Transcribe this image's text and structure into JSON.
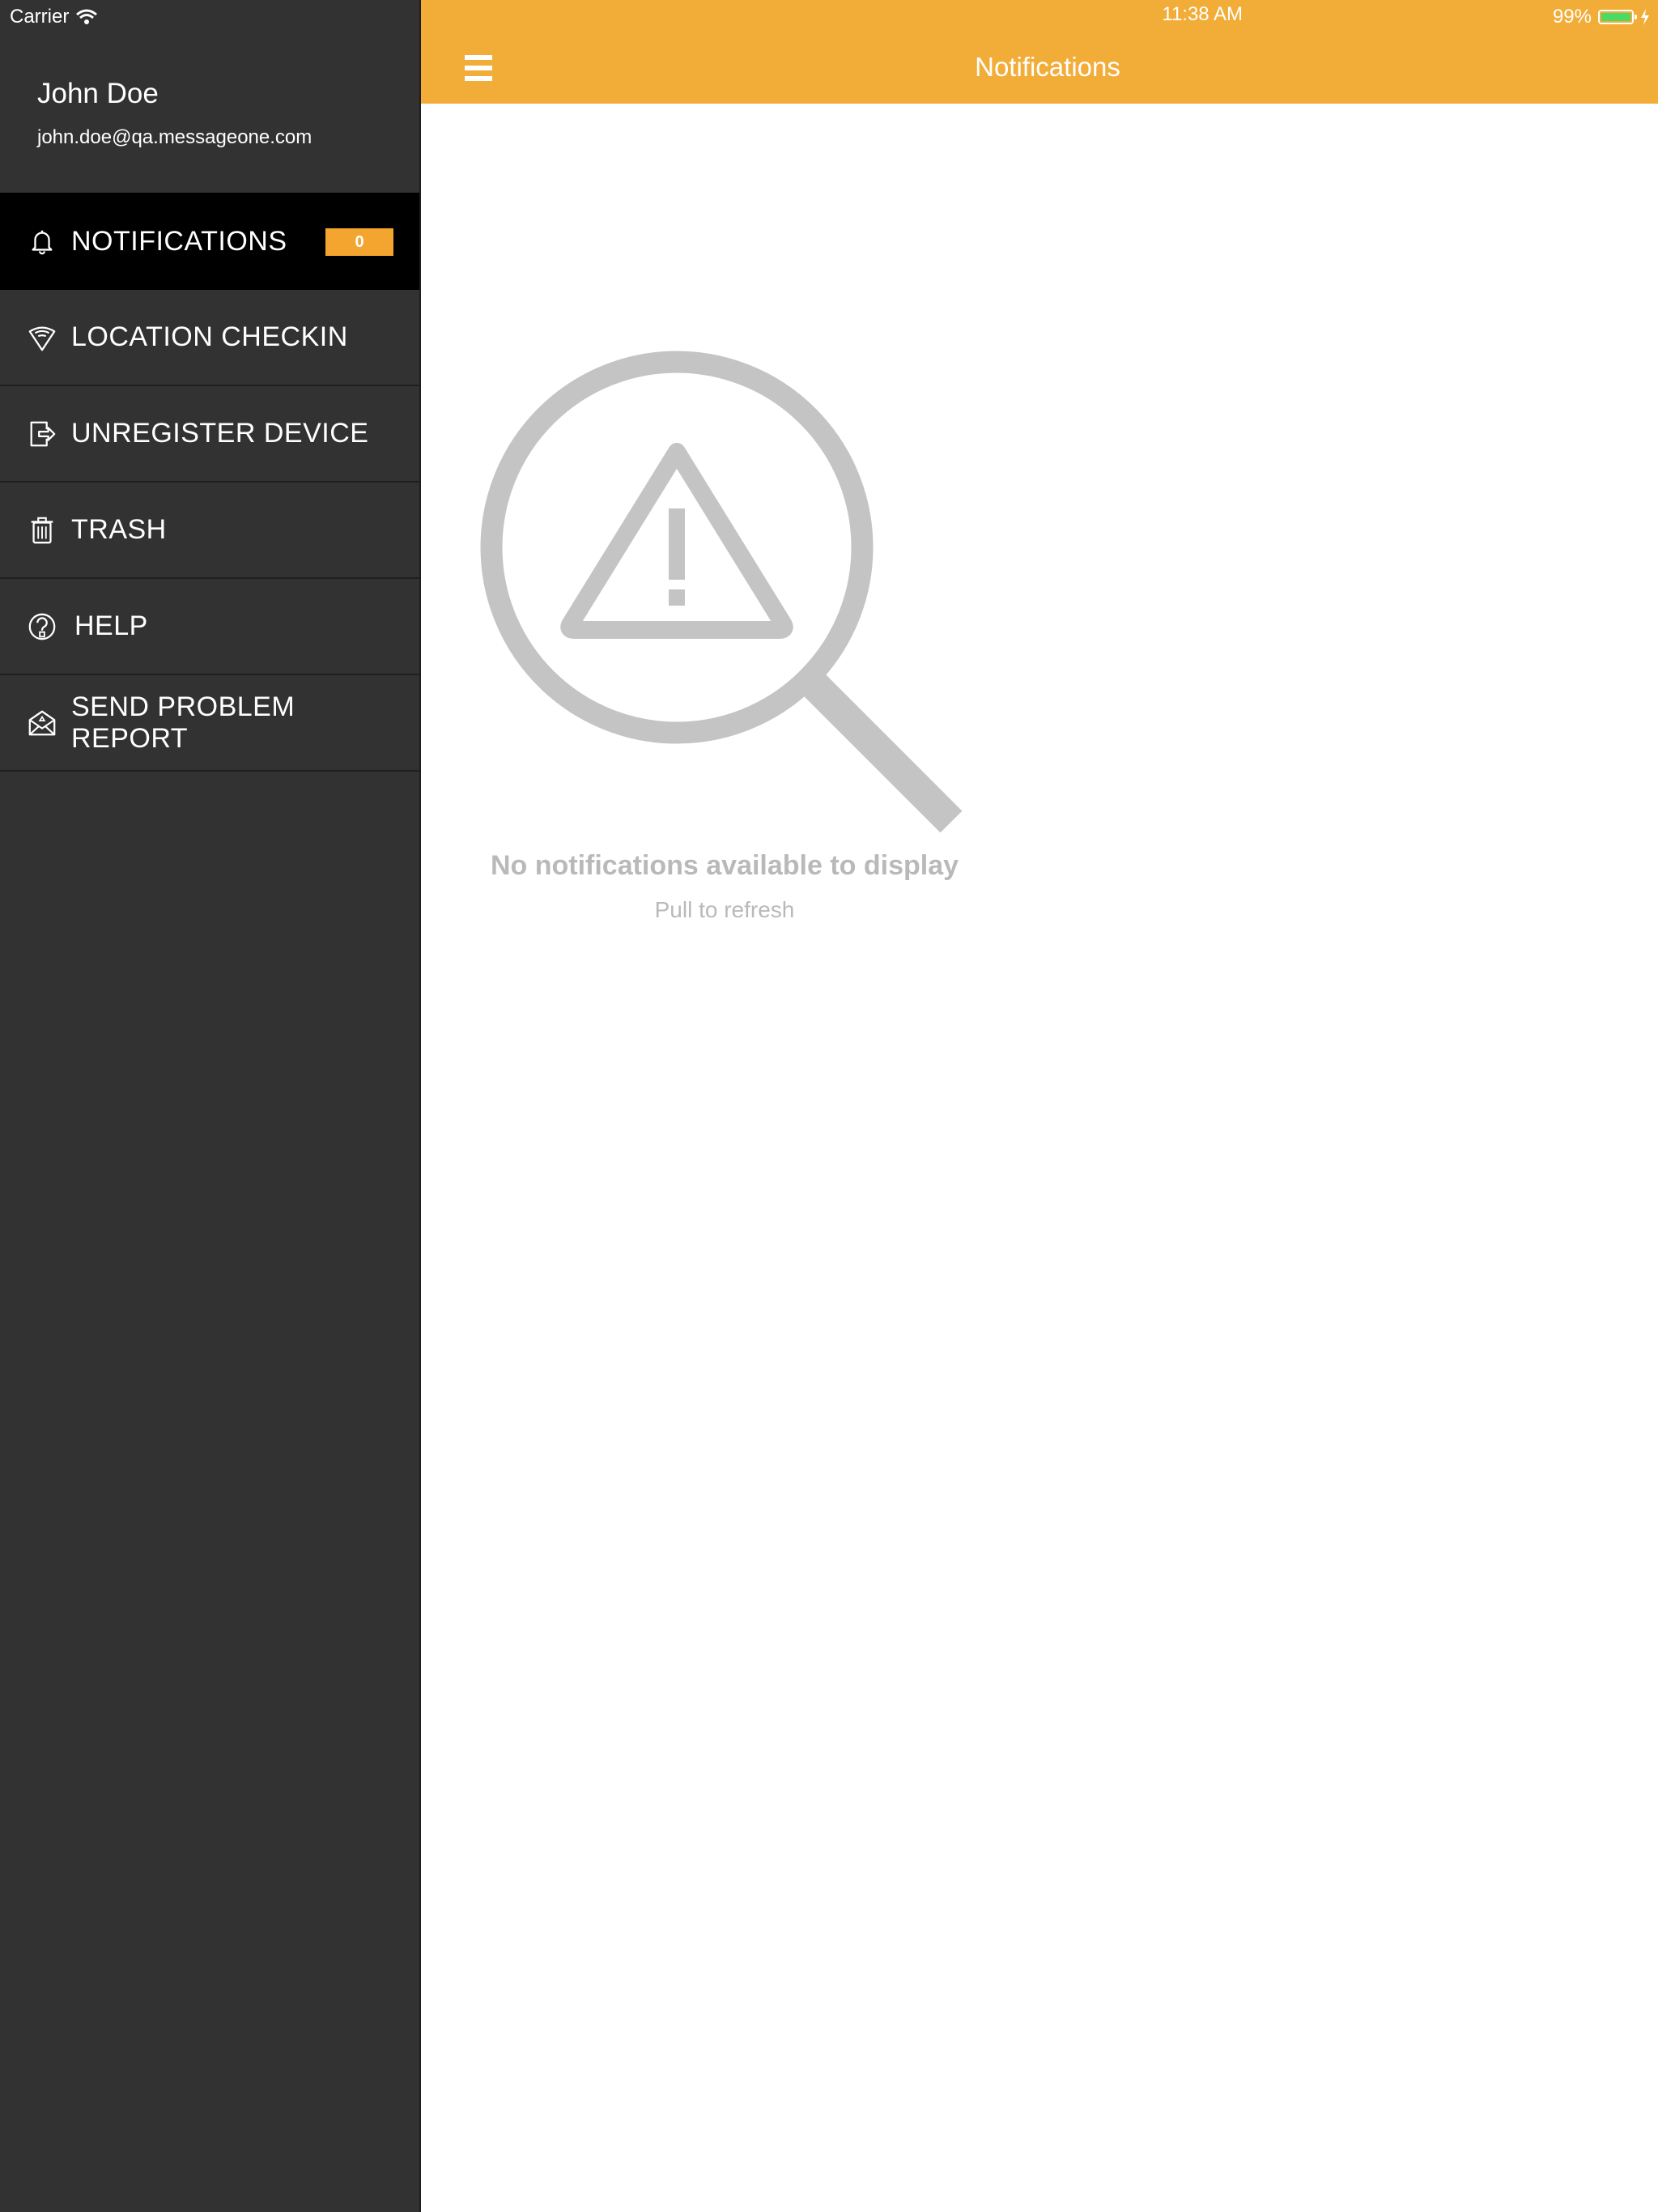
{
  "status_bar": {
    "carrier": "Carrier",
    "time": "11:38 AM",
    "battery": "99%",
    "battery_level": 0.99,
    "battery_color": "#4cd964"
  },
  "sidebar": {
    "user_name": "John Doe",
    "user_email": "john.doe@qa.messageone.com",
    "items": [
      {
        "label": "NOTIFICATIONS",
        "icon": "bell-icon",
        "badge": "0",
        "active": true
      },
      {
        "label": "LOCATION CHECKIN",
        "icon": "location-pin-icon"
      },
      {
        "label": "UNREGISTER DEVICE",
        "icon": "logout-icon"
      },
      {
        "label": "TRASH",
        "icon": "trash-icon"
      },
      {
        "label": "HELP",
        "icon": "help-icon"
      },
      {
        "label": "SEND PROBLEM REPORT",
        "icon": "mail-icon"
      }
    ]
  },
  "header": {
    "title": "Notifications",
    "menu_icon": "hamburger-icon"
  },
  "empty_state": {
    "icon": "magnifier-warning-icon",
    "title": "No notifications available to display",
    "subtitle": "Pull to refresh"
  },
  "colors": {
    "accent": "#f2ad38",
    "badge": "#f3a530",
    "sidebar_bg": "#323232",
    "active_item_bg": "#000000",
    "empty_gray": "#c4c4c4"
  }
}
